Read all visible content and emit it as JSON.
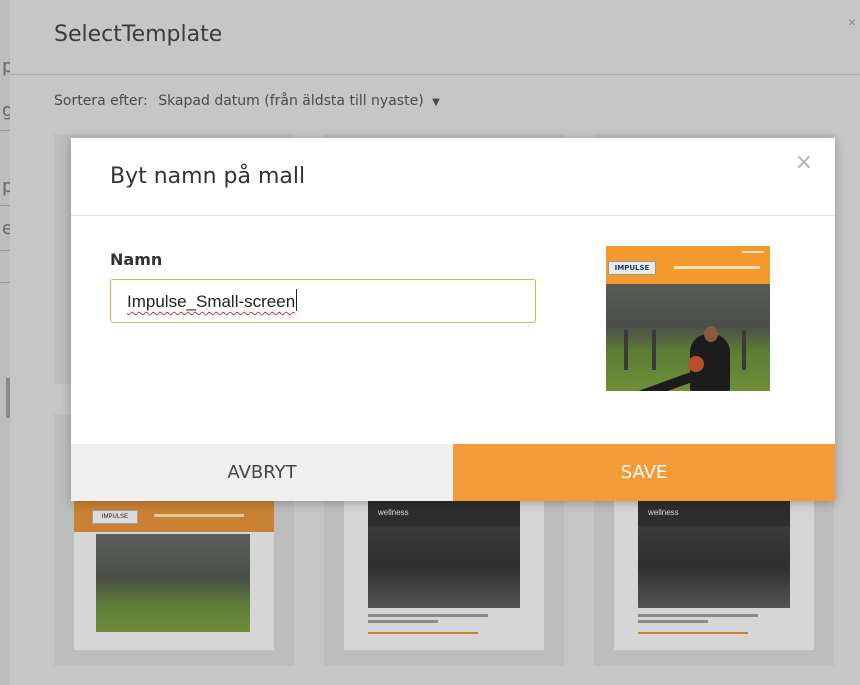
{
  "page": {
    "title": "SelectTemplate",
    "close_glyph": "×",
    "sort_label": "Sortera efter:",
    "sort_value": "Skapad datum (från äldsta till nyaste)",
    "left_strip_chars": [
      "p",
      "g",
      "p",
      "e"
    ]
  },
  "templates": [
    {
      "logo": "IMPULSE",
      "style": "impulse"
    },
    {
      "logo": "wellness",
      "style": "wellness"
    },
    {
      "logo": "wellness",
      "style": "wellness"
    }
  ],
  "modal": {
    "title": "Byt namn på mall",
    "close_glyph": "×",
    "field_label": "Namn",
    "name_value": "Impulse_Small-screen",
    "preview_logo": "IMPULSE",
    "cancel_label": "AVBRYT",
    "save_label": "SAVE"
  },
  "colors": {
    "accent": "#f39a39",
    "input_border": "#e8a95a",
    "overlay": "#c8c8c8"
  }
}
